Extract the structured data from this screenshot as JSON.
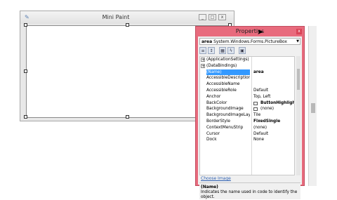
{
  "form": {
    "title": "Mini Paint",
    "caption_buttons": [
      "_",
      "□",
      "x"
    ]
  },
  "properties": {
    "window_title": "Properties",
    "close_label": "x",
    "object_selector": {
      "name": "area",
      "type": "System.Windows.Forms.PictureBox"
    },
    "toolbar_icons": [
      "categorized-icon",
      "alphabetical-icon",
      "properties-icon",
      "events-icon",
      "property-pages-icon"
    ],
    "rows": [
      {
        "name": "(ApplicationSettings)",
        "value": "",
        "expander": "+"
      },
      {
        "name": "(DataBindings)",
        "value": "",
        "expander": "+"
      },
      {
        "name": "(Name)",
        "value": "area",
        "selected": true,
        "bold": true
      },
      {
        "name": "AccessibleDescription",
        "value": ""
      },
      {
        "name": "AccessibleName",
        "value": ""
      },
      {
        "name": "AccessibleRole",
        "value": "Default"
      },
      {
        "name": "Anchor",
        "value": "Top, Left"
      },
      {
        "name": "BackColor",
        "value": "ButtonHighlight",
        "bold": true,
        "swatch": "#ffffff"
      },
      {
        "name": "BackgroundImage",
        "value": "(none)",
        "swatch": "#ffffff"
      },
      {
        "name": "BackgroundImageLayo",
        "value": "Tile"
      },
      {
        "name": "BorderStyle",
        "value": "FixedSingle",
        "bold": true
      },
      {
        "name": "ContextMenuStrip",
        "value": "(none)"
      },
      {
        "name": "Cursor",
        "value": "Default"
      },
      {
        "name": "Dock",
        "value": "None"
      }
    ],
    "command_link": "Choose Image",
    "description": {
      "name": "(Name)",
      "text": "Indicates the name used in code to identify the object."
    }
  },
  "colors": {
    "properties_frame": "#e86b7d",
    "selection": "#3399ff"
  }
}
